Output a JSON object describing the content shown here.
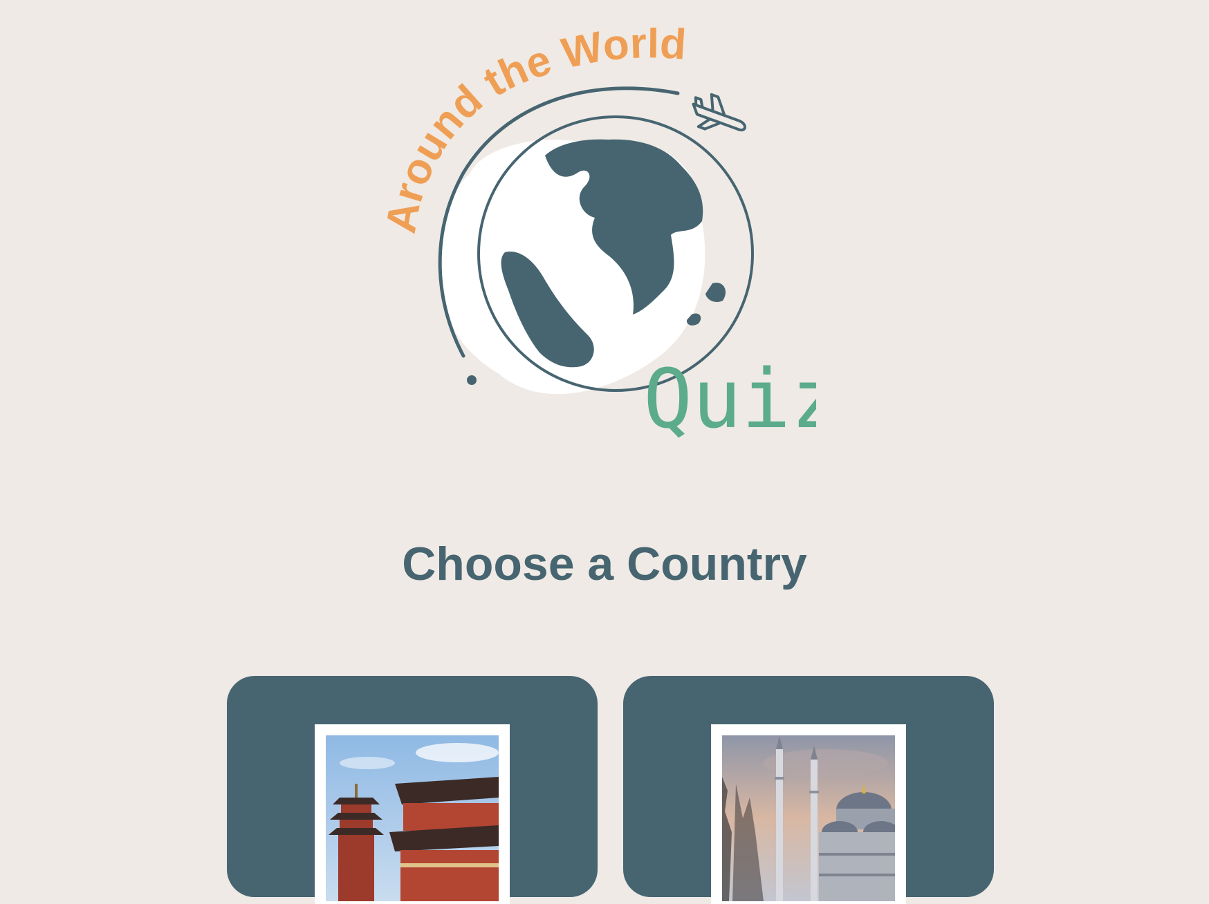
{
  "logo": {
    "title_arc": "Around the World",
    "subtitle": "Quiz",
    "colors": {
      "arc_text": "#ef9f55",
      "quiz_text": "#5bab8c",
      "globe": "#476571",
      "blob": "#ffffff"
    },
    "icons": [
      "airplane-icon",
      "globe-icon"
    ]
  },
  "heading": "Choose a Country",
  "countries": [
    {
      "label": "",
      "image": "pagoda-temple-photo"
    },
    {
      "label": "",
      "image": "mosque-photo"
    }
  ],
  "colors": {
    "background": "#efeae5",
    "card": "#476571",
    "heading": "#476571"
  }
}
